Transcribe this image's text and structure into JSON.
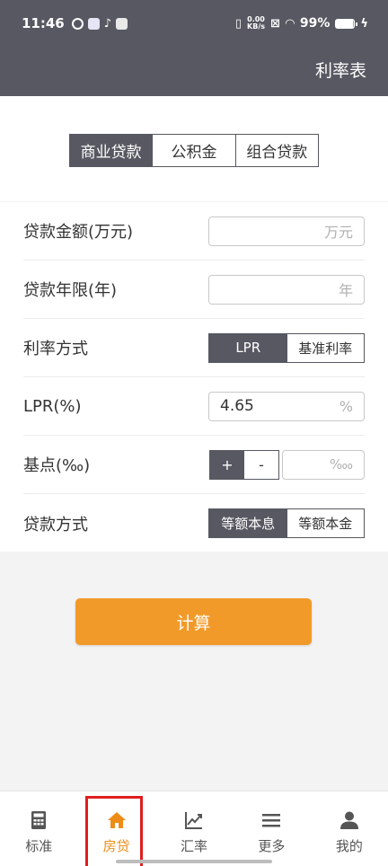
{
  "status_bar": {
    "time": "11:46",
    "net_speed_value": "0.00",
    "net_speed_unit": "KB/s",
    "battery": "99%"
  },
  "header": {
    "rate_table": "利率表"
  },
  "loan_tabs": [
    {
      "label": "商业贷款",
      "active": true
    },
    {
      "label": "公积金",
      "active": false
    },
    {
      "label": "组合贷款",
      "active": false
    }
  ],
  "form": {
    "amount": {
      "label": "贷款金额(万元)",
      "value": "",
      "unit": "万元"
    },
    "term": {
      "label": "贷款年限(年)",
      "value": "",
      "unit": "年"
    },
    "rate_mode": {
      "label": "利率方式",
      "options": [
        "LPR",
        "基准利率"
      ],
      "selected": "LPR"
    },
    "lpr": {
      "label": "LPR(%)",
      "value": "4.65",
      "unit": "%"
    },
    "basis_point": {
      "label": "基点(‰)",
      "plus": "+",
      "minus": "-",
      "unit": "‱"
    },
    "repay_mode": {
      "label": "贷款方式",
      "options": [
        "等额本息",
        "等额本金"
      ],
      "selected": "等额本息"
    }
  },
  "calculate_label": "计算",
  "bottom_nav": [
    {
      "label": "标准",
      "icon": "calculator-icon"
    },
    {
      "label": "房贷",
      "icon": "home-icon",
      "active": true
    },
    {
      "label": "汇率",
      "icon": "chart-line-icon"
    },
    {
      "label": "更多",
      "icon": "menu-icon"
    },
    {
      "label": "我的",
      "icon": "user-icon"
    }
  ],
  "colors": {
    "header_bg": "#575861",
    "accent": "#f29a29",
    "active_nav": "#ee8c19",
    "highlight_box": "#e01e1e"
  }
}
